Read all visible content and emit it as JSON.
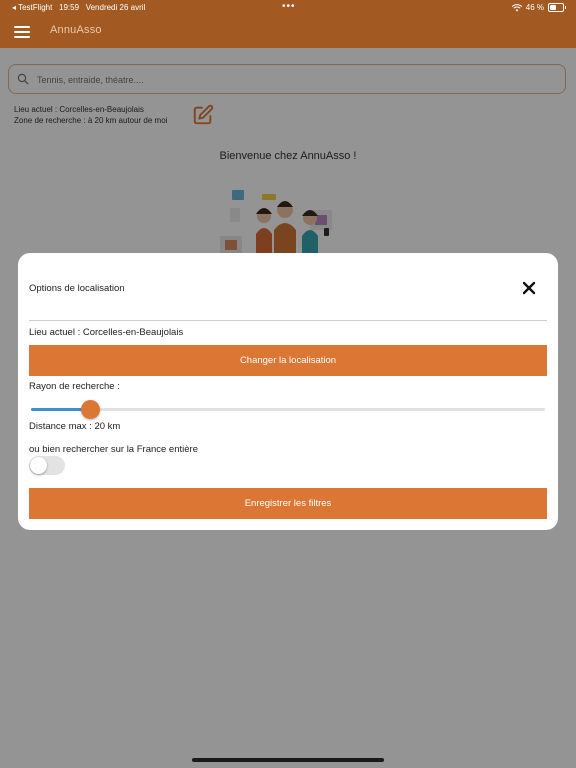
{
  "status_bar": {
    "carrier": "◂ TestFlight",
    "time": "19:59",
    "date": "Vendredi 26 avril",
    "dots": "•••",
    "battery_text": "46 %",
    "battery_level": 0.46
  },
  "app_bar": {
    "title": "AnnuAsso",
    "menu_icon": "hamburger-menu-icon"
  },
  "search": {
    "placeholder": "Tennis, entraide, théatre....",
    "icon": "search-icon"
  },
  "location_summary": {
    "current": "Lieu actuel : Corcelles-en-Beaujolais",
    "zone": "Zone de recherche : à 20 km autour de moi",
    "edit_icon": "edit-icon"
  },
  "welcome": {
    "text": "Bienvenue chez AnnuAsso !"
  },
  "modal": {
    "title": "Options de localisation",
    "current_location": "Lieu actuel : Corcelles-en-Beaujolais",
    "change_button": "Changer la localisation",
    "radius_label": "Rayon de recherche :",
    "slider_value_fraction": 0.115,
    "distance_label": "Distance max : 20 km",
    "france_label": "ou bien rechercher sur la France entière",
    "france_toggle_on": false,
    "save_button": "Enregistrer les filtres"
  },
  "colors": {
    "brand": "#a35a22",
    "accent": "#dc7634",
    "slider_fill": "#3d8fd1"
  }
}
